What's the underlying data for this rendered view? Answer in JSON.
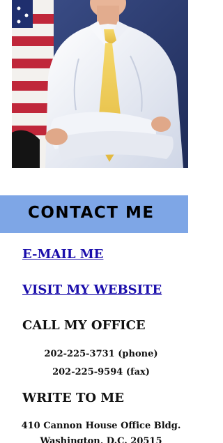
{
  "contact": {
    "header": "CONTACT ME",
    "email_link": "E-MAIL ME",
    "website_link": "VISIT MY WEBSITE",
    "call_heading": "CALL MY OFFICE",
    "phone": "202-225-3731 (phone)",
    "fax": "202-225-9594 (fax)",
    "write_heading": "WRITE TO ME",
    "address_line_1": "410 Cannon House Office Bldg.",
    "address_line_2": "Washington, D.C. 20515"
  },
  "colors": {
    "header_band": "#7ea6e6",
    "link": "#1a0dab"
  }
}
